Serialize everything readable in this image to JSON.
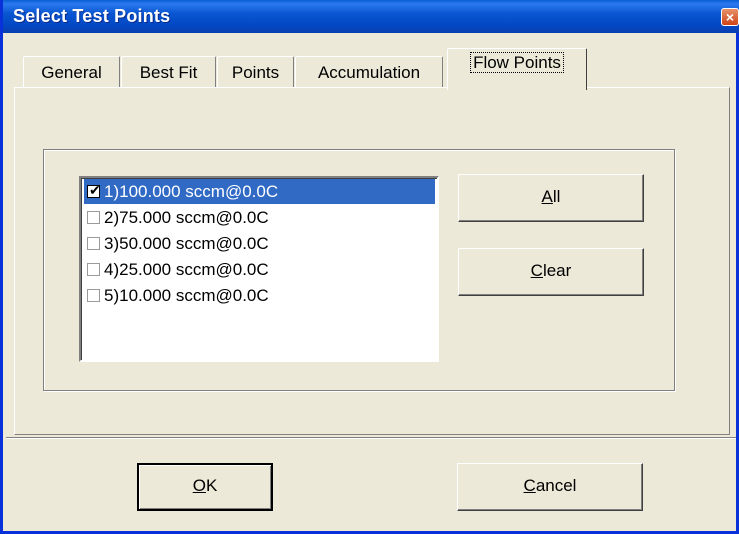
{
  "window": {
    "title": "Select Test Points",
    "close_icon": "×"
  },
  "tabs": [
    {
      "label": "General"
    },
    {
      "label": "Best Fit"
    },
    {
      "label": "Points"
    },
    {
      "label": "Accumulation"
    },
    {
      "label": "Flow Points",
      "active": true
    }
  ],
  "flow_points": {
    "items": [
      {
        "label": "1)100.000 sccm@0.0C",
        "checked": true,
        "selected": true
      },
      {
        "label": "2)75.000 sccm@0.0C",
        "checked": false
      },
      {
        "label": "3)50.000 sccm@0.0C",
        "checked": false
      },
      {
        "label": "4)25.000 sccm@0.0C",
        "checked": false
      },
      {
        "label": "5)10.000 sccm@0.0C",
        "checked": false
      }
    ],
    "all_button": {
      "mnemonic": "A",
      "rest": "ll"
    },
    "clear_button": {
      "mnemonic": "C",
      "rest": "lear"
    }
  },
  "footer": {
    "ok_button": {
      "mnemonic": "O",
      "rest": "K"
    },
    "cancel_button": {
      "mnemonic": "C",
      "rest": "ancel"
    }
  },
  "colors": {
    "selection": "#316ac5",
    "title_bar": "#0a57d3",
    "face": "#ece9d8"
  }
}
